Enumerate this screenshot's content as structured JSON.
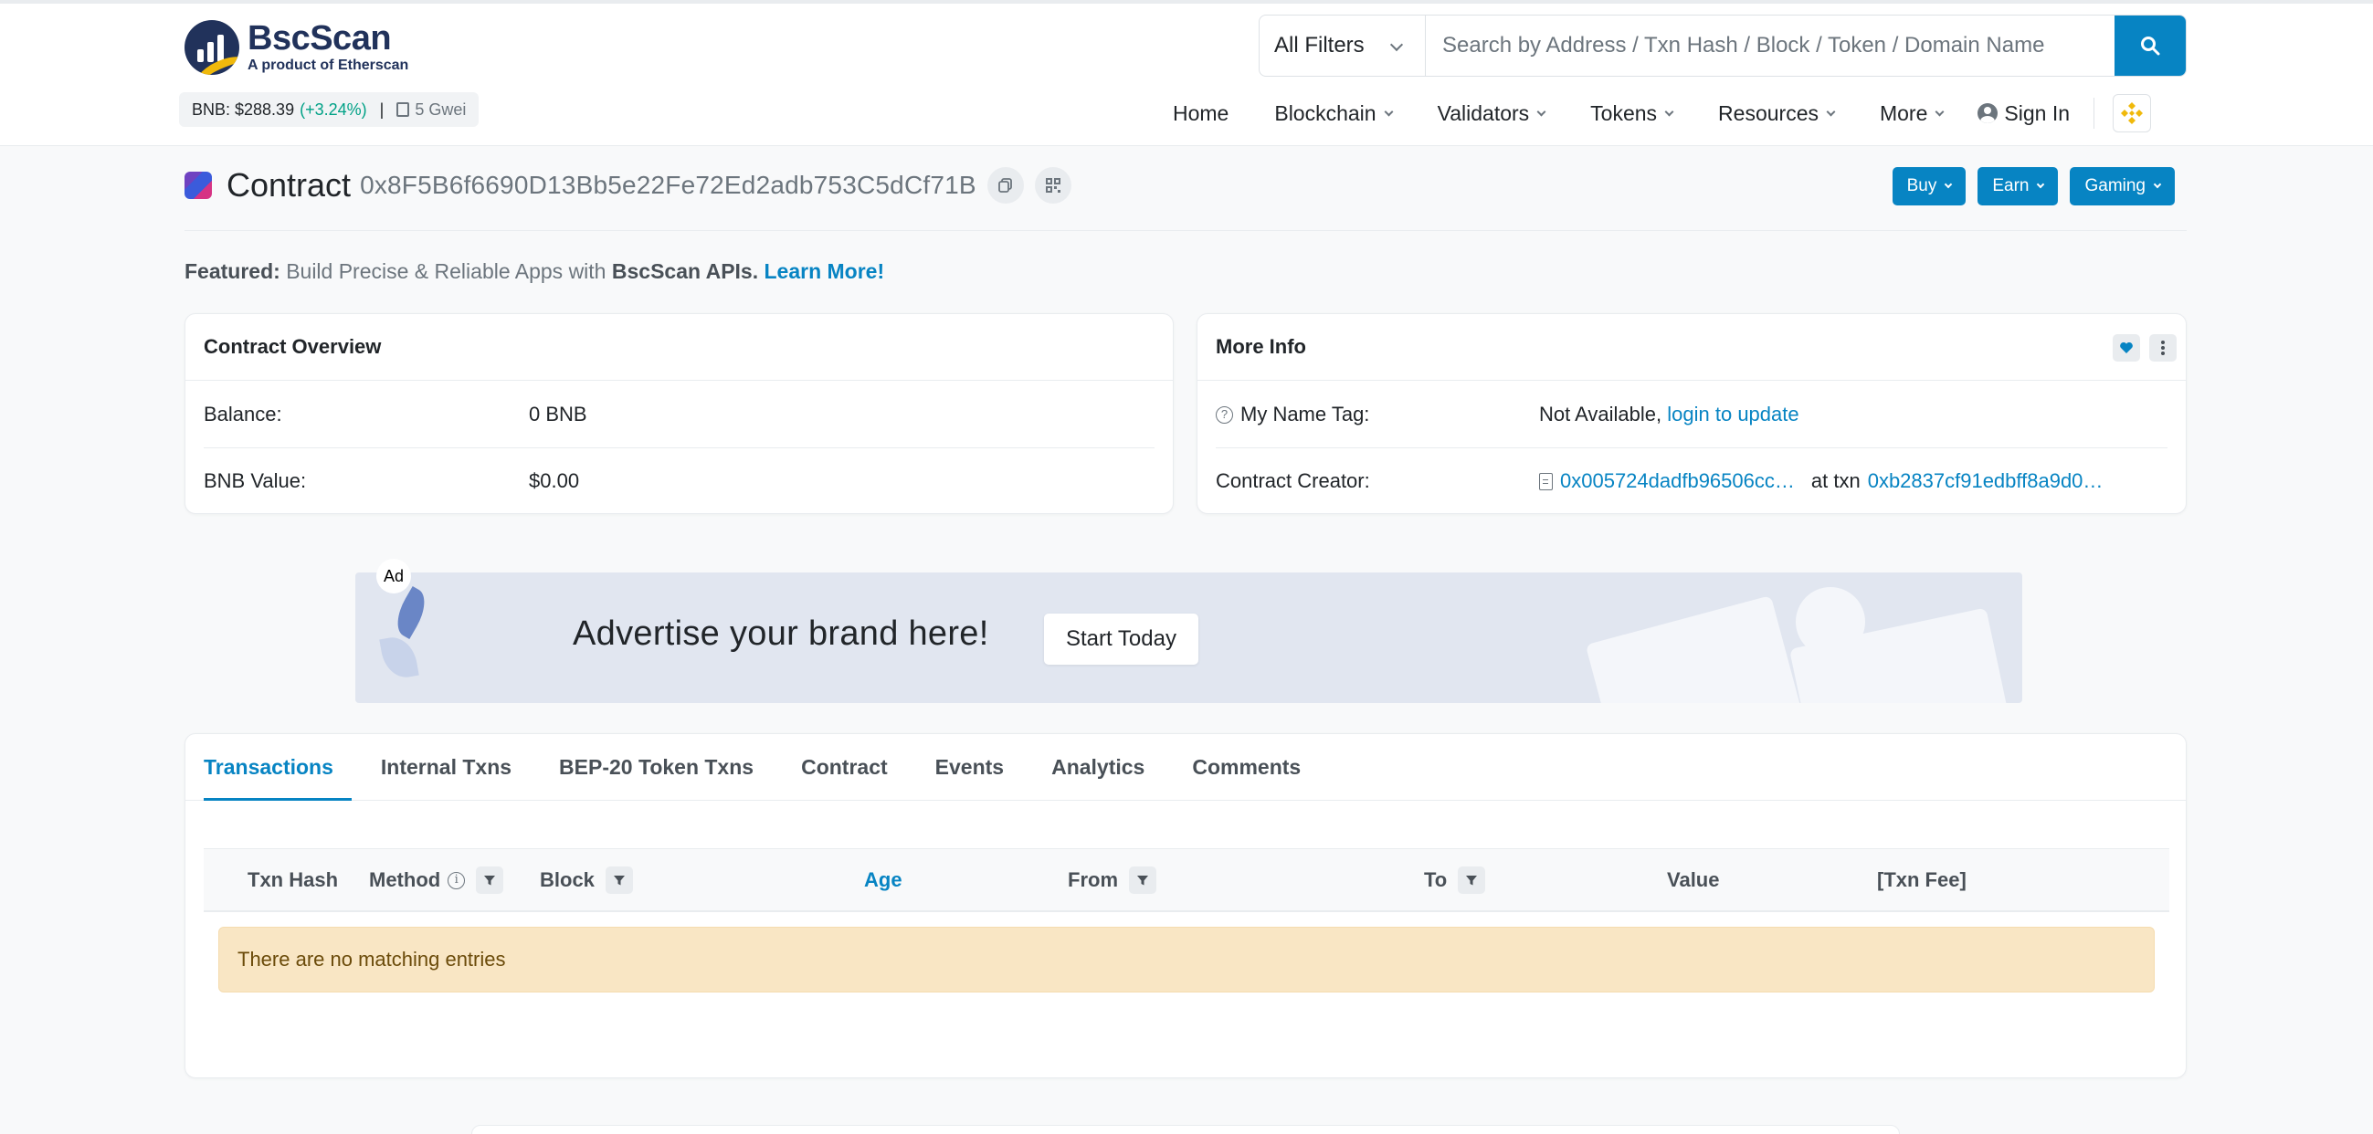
{
  "header": {
    "logo_name": "BscScan",
    "logo_sub": "A product of Etherscan",
    "bnb_price": "BNB: $288.39",
    "bnb_change": "(+3.24%)",
    "gas": "5 Gwei",
    "filter_label": "All Filters",
    "search_placeholder": "Search by Address / Txn Hash / Block / Token / Domain Name",
    "nav": [
      "Home",
      "Blockchain",
      "Validators",
      "Tokens",
      "Resources",
      "More"
    ],
    "sign_in": "Sign In"
  },
  "contract": {
    "title": "Contract",
    "address": "0x8F5B6f6690D13Bb5e22Fe72Ed2adb753C5dCf71B",
    "buttons": [
      "Buy",
      "Earn",
      "Gaming"
    ]
  },
  "featured": {
    "label": "Featured:",
    "text": "Build Precise & Reliable Apps with",
    "bold": "BscScan APIs.",
    "link": "Learn More!"
  },
  "overview": {
    "title": "Contract Overview",
    "balance_label": "Balance:",
    "balance_value": "0 BNB",
    "value_label": "BNB Value:",
    "value_value": "$0.00"
  },
  "more_info": {
    "title": "More Info",
    "name_tag_label": "My Name Tag:",
    "name_tag_value": "Not Available,",
    "name_tag_link": "login to update",
    "creator_label": "Contract Creator:",
    "creator_address": "0x005724dadfb96506cc…",
    "at_txn": "at txn",
    "creator_txn": "0xb2837cf91edbff8a9d0…"
  },
  "ad": {
    "label": "Ad",
    "text": "Advertise your brand here!",
    "button": "Start Today"
  },
  "tabs": [
    "Transactions",
    "Internal Txns",
    "BEP-20 Token Txns",
    "Contract",
    "Events",
    "Analytics",
    "Comments"
  ],
  "table": {
    "columns": [
      "Txn Hash",
      "Method",
      "Block",
      "Age",
      "From",
      "To",
      "Value",
      "[Txn Fee]"
    ],
    "empty_message": "There are no matching entries"
  },
  "colors": {
    "accent": "#0784c3",
    "positive": "#00a186",
    "brand_gold": "#f0b90b",
    "brand_navy": "#21325b",
    "empty_bg": "#f9e6c4"
  },
  "icons": [
    "search-icon",
    "chevron-down-icon",
    "user-circle-icon",
    "bnb-logo-icon",
    "copy-icon",
    "qr-code-icon",
    "question-icon",
    "heart-icon",
    "more-vertical-icon",
    "document-icon",
    "filter-icon",
    "info-icon",
    "gas-pump-icon"
  ]
}
